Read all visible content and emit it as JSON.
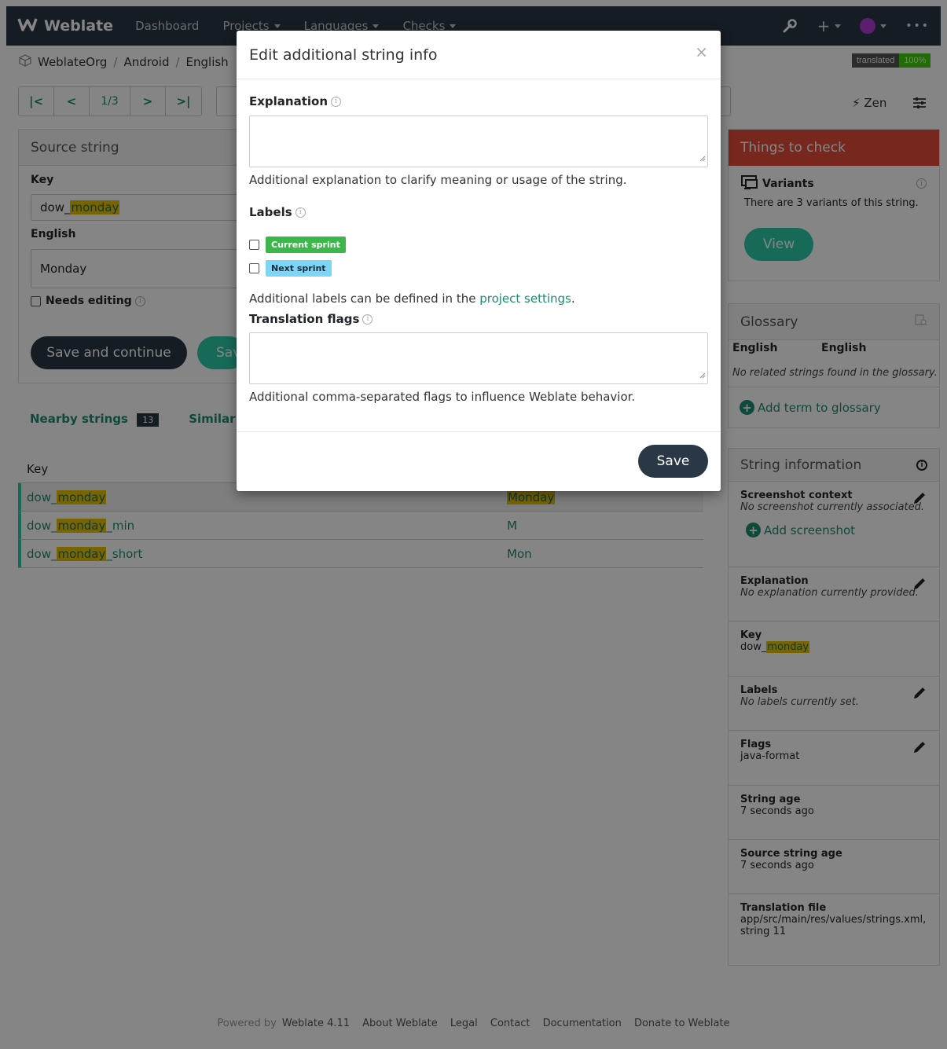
{
  "nav": {
    "brand": "Weblate",
    "items": [
      "Dashboard",
      "Projects",
      "Languages",
      "Checks"
    ]
  },
  "breadcrumb": [
    "WeblateOrg",
    "Android",
    "English"
  ],
  "status_badge": {
    "label": "translated",
    "value": "100%"
  },
  "pager": {
    "count": "1/3"
  },
  "zen_label": "Zen",
  "source": {
    "title": "Source string",
    "key_label": "Key",
    "key_prefix": "dow_",
    "key_highlight": "monday",
    "lang_label": "English",
    "source_text": "Monday",
    "needs_editing": "Needs editing",
    "save_continue": "Save and continue",
    "save_partial": "Sav"
  },
  "tabs": {
    "nearby": "Nearby strings",
    "nearby_count": "13",
    "similar": "Similar keys"
  },
  "nearby": {
    "header_key": "Key",
    "rows": [
      {
        "prefix": "dow_",
        "hl": "monday",
        "suffix": "",
        "value": "Monday"
      },
      {
        "prefix": "dow_",
        "hl": "monday",
        "suffix": "_min",
        "value": "M"
      },
      {
        "prefix": "dow_",
        "hl": "monday",
        "suffix": "_short",
        "value": "Mon"
      }
    ]
  },
  "checks": {
    "title": "Things to check",
    "variants_title": "Variants",
    "variants_desc": "There are 3 variants of this string.",
    "view": "View"
  },
  "glossary": {
    "title": "Glossary",
    "col_source": "English",
    "col_target": "English",
    "empty": "No related strings found in the glossary.",
    "add": "Add term to glossary"
  },
  "info": {
    "title": "String information",
    "screenshot_title": "Screenshot context",
    "screenshot_desc": "No screenshot currently associated.",
    "add_screenshot": "Add screenshot",
    "explanation_title": "Explanation",
    "explanation_desc": "No explanation currently provided.",
    "key_title": "Key",
    "key_prefix": "dow_",
    "key_hl": "monday",
    "labels_title": "Labels",
    "labels_desc": "No labels currently set.",
    "flags_title": "Flags",
    "flags_value": "java-format",
    "age_title": "String age",
    "age_value": "7 seconds ago",
    "src_age_title": "Source string age",
    "src_age_value": "7 seconds ago",
    "file_title": "Translation file",
    "file_value": "app/src/main/res/values/strings.xml,",
    "file_value2": "string 11"
  },
  "modal": {
    "title": "Edit additional string info",
    "close": "×",
    "explanation_label": "Explanation",
    "explanation_help": "Additional explanation to clarify meaning or usage of the string.",
    "labels_label": "Labels",
    "label1": "Current sprint",
    "label2": "Next sprint",
    "labels_help_pre": "Additional labels can be defined in the ",
    "labels_help_link": "project settings",
    "labels_help_post": ".",
    "flags_label": "Translation flags",
    "flags_help": "Additional comma-separated flags to influence Weblate behavior.",
    "save": "Save"
  },
  "footer": {
    "powered_by": "Powered by",
    "version": "Weblate 4.11",
    "links": [
      "About Weblate",
      "Legal",
      "Contact",
      "Documentation",
      "Donate to Weblate"
    ]
  },
  "colors": {
    "navbar": "#2a3744",
    "accent": "#1d8c73",
    "highlight": "#e7c000",
    "danger": "#e74c3c",
    "label_current": "#3cb84b",
    "label_next": "#7ed6f7"
  }
}
